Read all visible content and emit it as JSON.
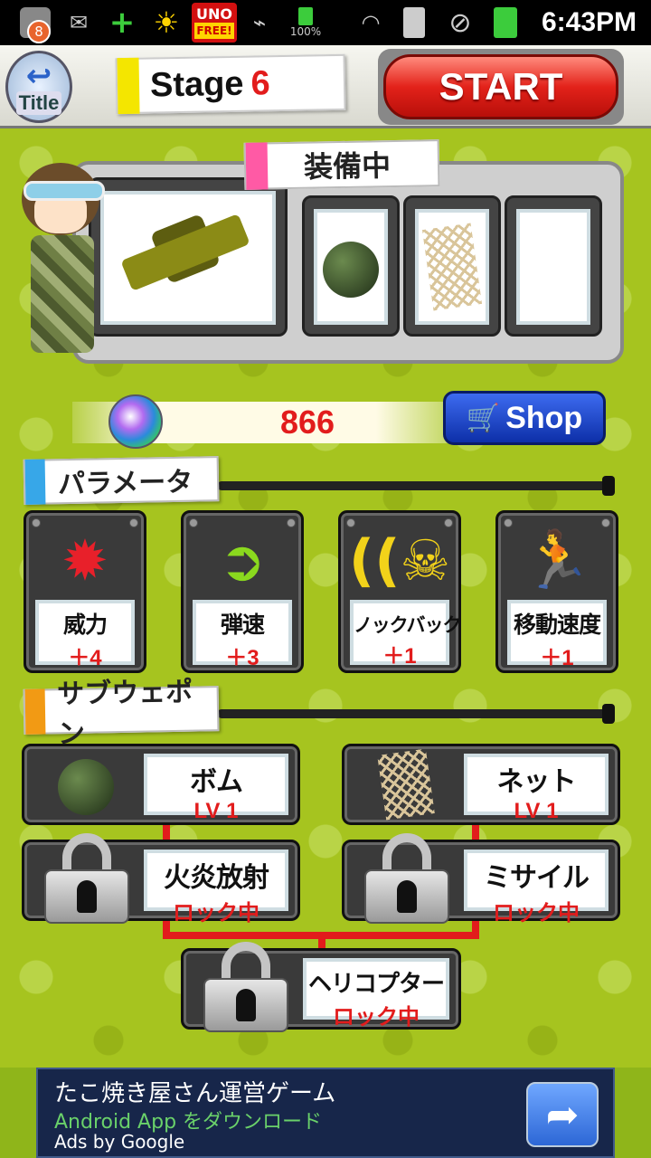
{
  "status_bar": {
    "notification_count": "8",
    "battery_text": "100%",
    "time": "6:43PM",
    "icons": [
      "mail-icon",
      "plus-icon",
      "sun-icon",
      "uno-icon",
      "usb-icon",
      "battery-icon",
      "wifi-icon",
      "sim-icon",
      "block-icon",
      "battery-full-icon"
    ],
    "uno_label": "UNO",
    "uno_sub": "FREE!"
  },
  "header": {
    "title_button": "Title",
    "stage_label": "Stage",
    "stage_number": "6",
    "start_button": "START"
  },
  "equipment": {
    "title": "装備中",
    "slots": [
      "rifle",
      "grenade",
      "net",
      "empty"
    ]
  },
  "currency": {
    "amount": "866",
    "shop_button": "Shop"
  },
  "parameters": {
    "title": "パラメータ",
    "items": [
      {
        "name": "威力",
        "value": "＋4",
        "icon": "burst-icon"
      },
      {
        "name": "弾速",
        "value": "＋3",
        "icon": "bullet-icon"
      },
      {
        "name": "ノックバック",
        "value": "＋1",
        "icon": "knockback-icon"
      },
      {
        "name": "移動速度",
        "value": "＋1",
        "icon": "running-icon"
      }
    ]
  },
  "subweapons": {
    "title": "サブウェポン",
    "items": [
      {
        "name": "ボム",
        "status": "LV 1",
        "locked": false
      },
      {
        "name": "ネット",
        "status": "LV 1",
        "locked": false
      },
      {
        "name": "火炎放射",
        "status": "ロック中",
        "locked": true
      },
      {
        "name": "ミサイル",
        "status": "ロック中",
        "locked": true
      },
      {
        "name": "ヘリコプター",
        "status": "ロック中",
        "locked": true
      }
    ]
  },
  "ad": {
    "title": "たこ焼き屋さん運営ゲーム",
    "subtitle": "Android App をダウンロード",
    "attribution": "Ads by Google"
  },
  "colors": {
    "background": "#a6c41f",
    "accent_red": "#e21c1c",
    "shop_blue": "#1a3cc8"
  }
}
